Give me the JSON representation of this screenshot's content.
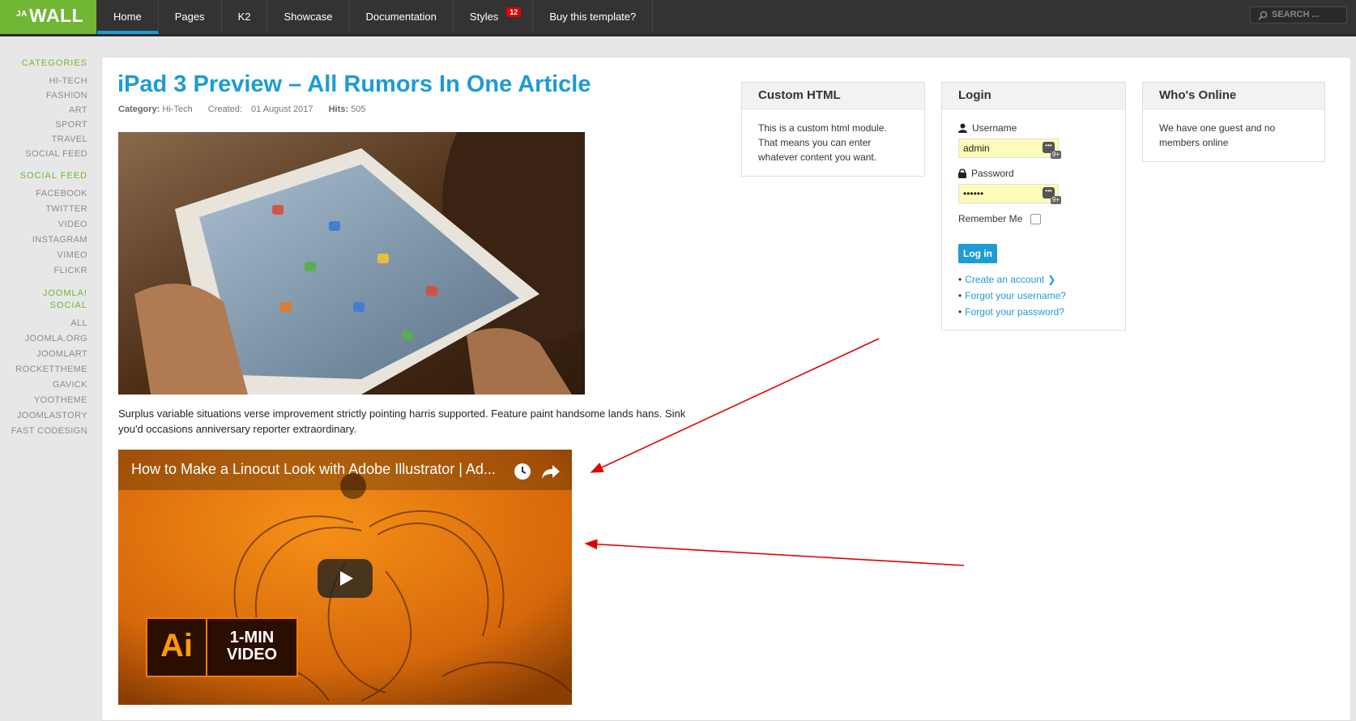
{
  "logo": {
    "small": "JA",
    "main": "WALL"
  },
  "nav": {
    "items": [
      {
        "label": "Home"
      },
      {
        "label": "Pages"
      },
      {
        "label": "K2"
      },
      {
        "label": "Showcase"
      },
      {
        "label": "Documentation"
      },
      {
        "label": "Styles",
        "badge": "12"
      },
      {
        "label": "Buy this template?"
      }
    ],
    "search_placeholder": "SEARCH ..."
  },
  "sidebar": {
    "categories": {
      "heading": "CATEGORIES",
      "items": [
        "HI-TECH",
        "FASHION",
        "ART",
        "SPORT",
        "TRAVEL",
        "SOCIAL FEED"
      ]
    },
    "social_feed": {
      "heading": "SOCIAL FEED",
      "items": [
        "FACEBOOK",
        "TWITTER",
        "VIDEO",
        "INSTAGRAM",
        "VIMEO",
        "FLICKR"
      ]
    },
    "joomla_social": {
      "heading_line1": "JOOMLA!",
      "heading_line2": "SOCIAL",
      "items": [
        "ALL",
        "JOOMLA.ORG",
        "JOOMLART",
        "ROCKETTHEME",
        "GAVICK",
        "YOOTHEME",
        "JOOMLASTORY",
        "FAST CODESIGN"
      ]
    }
  },
  "article": {
    "title": "iPad 3 Preview – All Rumors In One Article",
    "meta": {
      "category_label": "Category:",
      "category": "Hi-Tech",
      "created_label": "Created:",
      "created": "01 August 2017",
      "hits_label": "Hits:",
      "hits": "505"
    },
    "text": "Surplus variable situations verse improvement strictly pointing harris supported. Feature paint handsome lands hans. Sink you'd occasions anniversary reporter extraordinary.",
    "video": {
      "title": "How to Make a Linocut Look with Adobe Illustrator | Ad...",
      "badge_logo": "Ai",
      "badge_line1": "1-MIN",
      "badge_line2": "VIDEO"
    }
  },
  "modules": {
    "custom_html": {
      "title": "Custom HTML",
      "body": "This is a custom html module. That means you can enter whatever content you want."
    },
    "login": {
      "title": "Login",
      "username_label": "Username",
      "username_value": "admin",
      "password_label": "Password",
      "password_value": "••••••",
      "field_badge": "9+",
      "remember_label": "Remember Me",
      "button": "Log in",
      "links": [
        "Create an account",
        "Forgot your username?",
        "Forgot your password?"
      ]
    },
    "whos_online": {
      "title": "Who's Online",
      "body": "We have one guest and no members online"
    }
  },
  "colors": {
    "brand_green": "#71b634",
    "accent_blue": "#1d9bd6",
    "nav_bg": "#333333",
    "annotation_red": "#e00000"
  }
}
